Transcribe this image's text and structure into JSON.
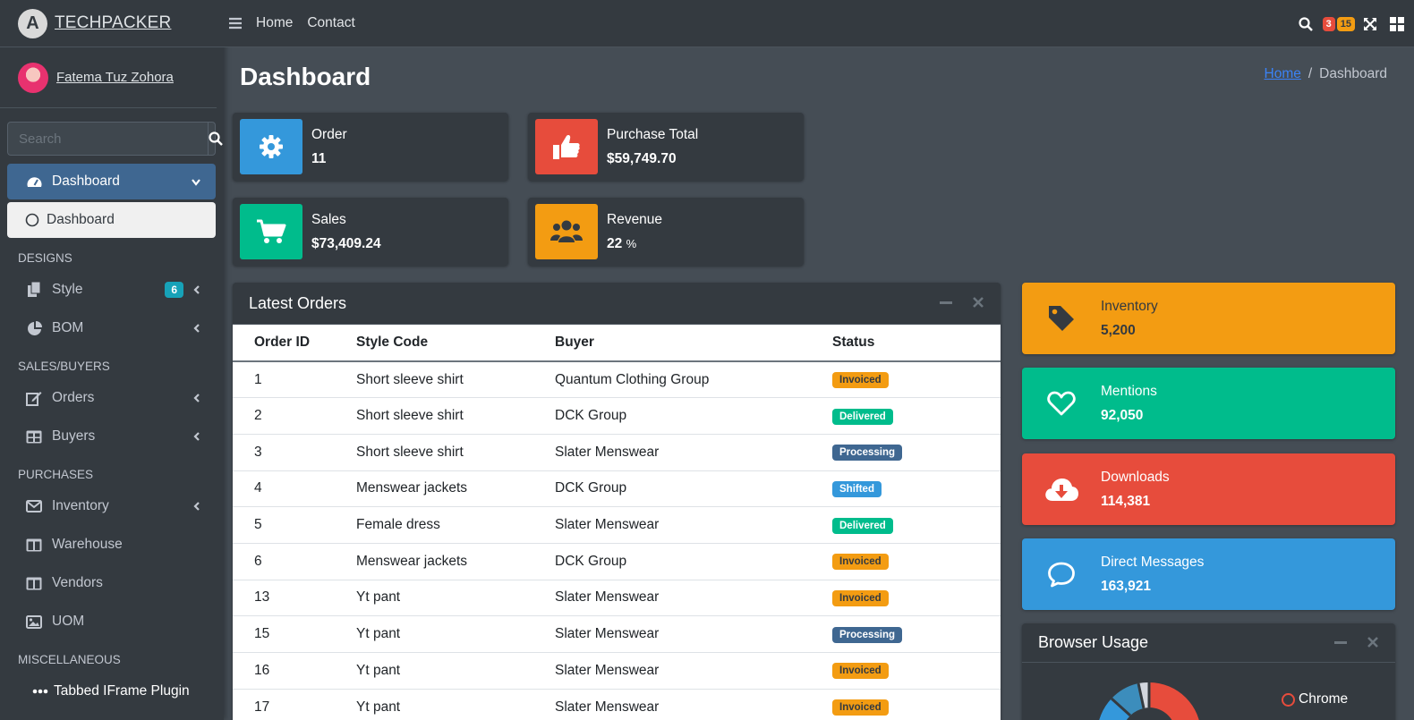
{
  "brand": {
    "name": "TECHPACKER",
    "logo_letter": "A"
  },
  "user": {
    "name": "Fatema Tuz Zohora"
  },
  "search": {
    "placeholder": "Search"
  },
  "sidebar": {
    "dashboard": "Dashboard",
    "dashboard_sub": "Dashboard",
    "headers": {
      "designs": "DESIGNS",
      "sales": "SALES/BUYERS",
      "purchases": "PURCHASES",
      "misc": "MISCELLANEOUS"
    },
    "style": {
      "label": "Style",
      "badge": "6"
    },
    "bom": "BOM",
    "orders": "Orders",
    "buyers": "Buyers",
    "inventory": "Inventory",
    "warehouse": "Warehouse",
    "vendors": "Vendors",
    "uom": "UOM",
    "iframe": "Tabbed IFrame Plugin"
  },
  "topbar": {
    "home": "Home",
    "contact": "Contact",
    "badge_red": "3",
    "badge_yellow": "15"
  },
  "page": {
    "title": "Dashboard",
    "breadcrumb_home": "Home",
    "breadcrumb_current": "Dashboard"
  },
  "info_boxes": {
    "order": {
      "label": "Order",
      "value": "11"
    },
    "purchase": {
      "label": "Purchase Total",
      "value": "$59,749.70"
    },
    "sales": {
      "label": "Sales",
      "value": "$73,409.24"
    },
    "revenue": {
      "label": "Revenue",
      "value": "22",
      "unit": "%"
    }
  },
  "orders": {
    "title": "Latest Orders",
    "columns": {
      "id": "Order ID",
      "style": "Style Code",
      "buyer": "Buyer",
      "status": "Status"
    },
    "rows": [
      {
        "id": "1",
        "style": "Short sleeve shirt",
        "buyer": "Quantum Clothing Group",
        "status": "Invoiced"
      },
      {
        "id": "2",
        "style": "Short sleeve shirt",
        "buyer": "DCK Group",
        "status": "Delivered"
      },
      {
        "id": "3",
        "style": "Short sleeve shirt",
        "buyer": "Slater Menswear",
        "status": "Processing"
      },
      {
        "id": "4",
        "style": "Menswear jackets",
        "buyer": "DCK Group",
        "status": "Shifted"
      },
      {
        "id": "5",
        "style": "Female dress",
        "buyer": "Slater Menswear",
        "status": "Delivered"
      },
      {
        "id": "6",
        "style": "Menswear jackets",
        "buyer": "DCK Group",
        "status": "Invoiced"
      },
      {
        "id": "13",
        "style": "Yt pant",
        "buyer": "Slater Menswear",
        "status": "Invoiced"
      },
      {
        "id": "15",
        "style": "Yt pant",
        "buyer": "Slater Menswear",
        "status": "Processing"
      },
      {
        "id": "16",
        "style": "Yt pant",
        "buyer": "Slater Menswear",
        "status": "Invoiced"
      },
      {
        "id": "17",
        "style": "Yt pant",
        "buyer": "Slater Menswear",
        "status": "Invoiced"
      }
    ]
  },
  "status_colors": {
    "Invoiced": "#f39c12",
    "Delivered": "#00bc8c",
    "Processing": "#3f6791",
    "Shifted": "#3498db"
  },
  "stats": {
    "inventory": {
      "label": "Inventory",
      "value": "5,200"
    },
    "mentions": {
      "label": "Mentions",
      "value": "92,050"
    },
    "downloads": {
      "label": "Downloads",
      "value": "114,381"
    },
    "messages": {
      "label": "Direct Messages",
      "value": "163,921"
    }
  },
  "browser_usage": {
    "title": "Browser Usage",
    "legend_first": "Chrome"
  },
  "colors": {
    "blue": "#3498db",
    "red": "#e74c3c",
    "green": "#00bc8c",
    "orange": "#f39c12"
  }
}
